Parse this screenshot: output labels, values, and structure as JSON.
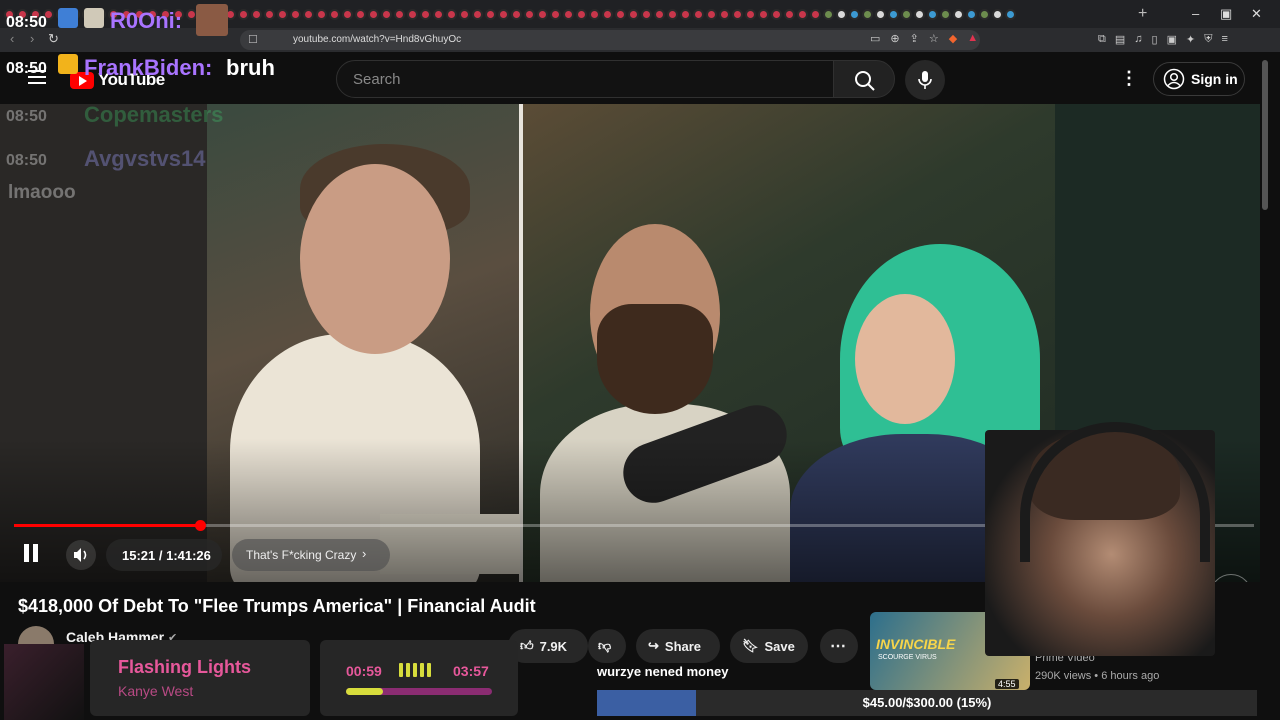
{
  "browser": {
    "url": "youtube.com/watch?v=Hnd8vGhuyOc",
    "window_min": "–",
    "window_max": "▣",
    "window_close": "✕",
    "new_tab": "+"
  },
  "youtube": {
    "logo_text": "YouTube",
    "search_placeholder": "Search",
    "sign_in_label": "Sign in"
  },
  "player": {
    "time_display": "15:21 / 1:41:26",
    "chapter_label": "That's F*cking Crazy",
    "progress": 0.15
  },
  "chat": {
    "clock": "08:50",
    "messages": [
      {
        "time": "08:50",
        "user": "R0Oni:",
        "text": "",
        "user_color": "#a974ff"
      },
      {
        "time": "08:50",
        "user": "FrankBiden:",
        "text": "bruh",
        "user_color": "#a974ff"
      },
      {
        "time": "08:50",
        "user": "Copemasters",
        "text": "",
        "user_color": "#3fbf6a"
      },
      {
        "time": "08:50",
        "user": "Avgvstvs14",
        "text": "",
        "user_color": "#a0a0ff"
      },
      {
        "time": "",
        "user": "",
        "text": "lmaooo",
        "user_color": "#ffffff"
      }
    ]
  },
  "video": {
    "title": "$418,000 Of Debt To \"Flee Trumps America\" | Financial Audit",
    "channel": "Caleb Hammer",
    "likes": "7.9K",
    "share_label": "Share",
    "save_label": "Save"
  },
  "recommended": {
    "thumb_title": "INVINCIBLE",
    "thumb_sub": "SCOURGE VIRUS",
    "duration": "4:55",
    "channel": "Prime Video",
    "meta": "290K views • 6 hours ago"
  },
  "now_playing": {
    "song": "Flashing Lights",
    "artist": "Kanye West",
    "elapsed": "00:59",
    "total": "03:57",
    "progress": 0.25
  },
  "donation_goal": {
    "label": "wurzye nened money",
    "status": "$45.00/$300.00 (15%)",
    "progress": 0.15
  },
  "colors": {
    "accent_red": "#ff0000",
    "now_playing_pink": "#e7589b",
    "goal_blue": "#3b5fa3"
  }
}
